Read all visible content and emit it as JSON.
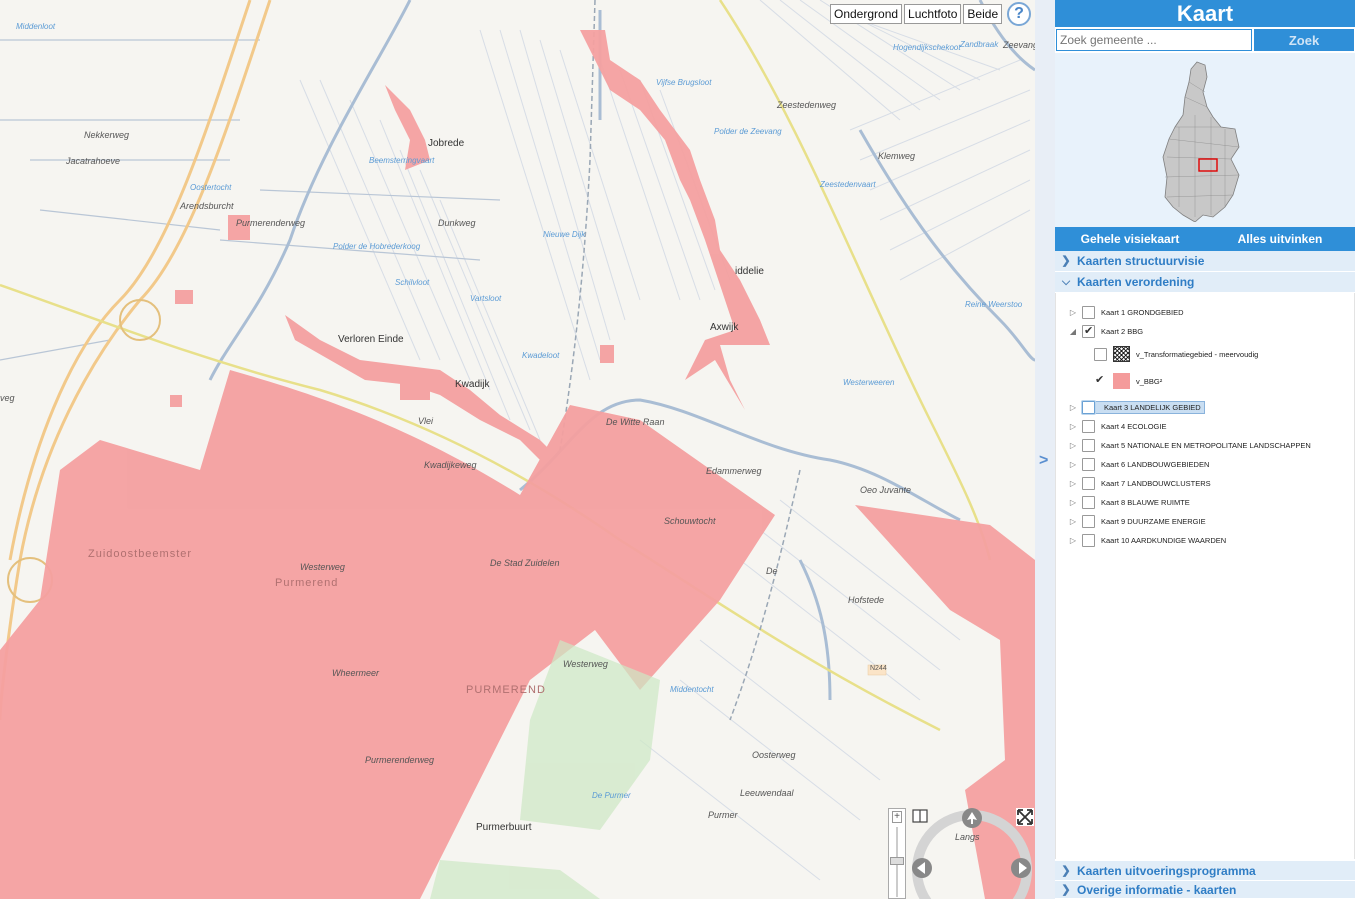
{
  "map": {
    "type_buttons": [
      "Ondergrond",
      "Luchtfoto",
      "Beide"
    ],
    "help": "?",
    "collapse_arrow": ">",
    "zoom_plus": "+",
    "labels": [
      {
        "text": "Jobrede",
        "cls": "town"
      },
      {
        "text": "Verloren Einde",
        "cls": "town"
      },
      {
        "text": "Kwadijk",
        "cls": "town"
      },
      {
        "text": "Axwijk",
        "cls": "town"
      },
      {
        "text": "iddelie",
        "cls": "town"
      },
      {
        "text": "Nekkerweg",
        "cls": ""
      },
      {
        "text": "Jacatrahoeve",
        "cls": ""
      },
      {
        "text": "Arendsburcht",
        "cls": ""
      },
      {
        "text": "Purmerenderweg",
        "cls": ""
      },
      {
        "text": "Dunkweg",
        "cls": ""
      },
      {
        "text": "Zeestedenweg",
        "cls": ""
      },
      {
        "text": "Klemweg",
        "cls": ""
      },
      {
        "text": "Edammerweg",
        "cls": ""
      },
      {
        "text": "Oeo Juvante",
        "cls": ""
      },
      {
        "text": "Hofstede",
        "cls": ""
      },
      {
        "text": "Westerweg",
        "cls": ""
      },
      {
        "text": "Oosterweg",
        "cls": ""
      },
      {
        "text": "Leeuwendaal",
        "cls": ""
      },
      {
        "text": "Purmerbuurt",
        "cls": "town"
      },
      {
        "text": "Middenloot",
        "cls": "water"
      },
      {
        "text": "Oostertocht",
        "cls": "water"
      },
      {
        "text": "Beemsterringvaart",
        "cls": "water"
      },
      {
        "text": "Polder de Hobrederkoog",
        "cls": "water"
      },
      {
        "text": "Nieuwe Dijk",
        "cls": "water"
      },
      {
        "text": "Schilvloot",
        "cls": "water"
      },
      {
        "text": "Vartsloot",
        "cls": "water"
      },
      {
        "text": "Kwadeloot",
        "cls": "water"
      },
      {
        "text": "Vijfse Brugsloot",
        "cls": "water"
      },
      {
        "text": "Polder de Zeevang",
        "cls": "water"
      },
      {
        "text": "Zeestedenvaart",
        "cls": "water"
      },
      {
        "text": "Westerweeren",
        "cls": "water"
      },
      {
        "text": "Reine Weerstoo",
        "cls": "water"
      },
      {
        "text": "Hogendijkschekoot",
        "cls": "water"
      },
      {
        "text": "Zandbraak",
        "cls": "water"
      },
      {
        "text": "Middentocht",
        "cls": "water"
      },
      {
        "text": "De Purmer",
        "cls": "water"
      },
      {
        "text": "Vlei",
        "cls": ""
      },
      {
        "text": "De Witte Raan",
        "cls": ""
      },
      {
        "text": "Zuidoostbeemster",
        "cls": "big"
      },
      {
        "text": "Purmerend",
        "cls": "big"
      },
      {
        "text": "PURMEREND",
        "cls": "big"
      },
      {
        "text": "Wheermeer",
        "cls": ""
      },
      {
        "text": "De Stad Zuidelen",
        "cls": ""
      },
      {
        "text": "Westerweg",
        "cls": ""
      },
      {
        "text": "Zeevangdijk",
        "cls": ""
      },
      {
        "text": "N244",
        "cls": ""
      },
      {
        "text": "veg",
        "cls": ""
      },
      {
        "text": "Kwadijkeweg",
        "cls": ""
      },
      {
        "text": "Purmerenderweg",
        "cls": ""
      },
      {
        "text": "Schouwtocht",
        "cls": ""
      },
      {
        "text": "Purmer",
        "cls": ""
      },
      {
        "text": "De",
        "cls": ""
      },
      {
        "text": "Langs",
        "cls": ""
      }
    ]
  },
  "panel": {
    "title": "Kaart",
    "search_placeholder": "Zoek gemeente ...",
    "search_button": "Zoek",
    "actions": [
      "Gehele visiekaart",
      "Alles uitvinken"
    ],
    "sections_top": [
      {
        "label": "Kaarten structuurvisie",
        "open": false
      },
      {
        "label": "Kaarten verordening",
        "open": true
      }
    ],
    "layers": [
      {
        "label": "Kaart 1 GRONDGEBIED",
        "checked": false,
        "expander": "▷",
        "indent": 0
      },
      {
        "label": "Kaart 2 BBG",
        "checked": true,
        "expander": "◢",
        "indent": 0
      },
      {
        "label": "v_Transformatiegebied - meervoudig",
        "checked": false,
        "expander": "",
        "indent": 1,
        "swatch": "hatch"
      },
      {
        "label": "v_BBG²",
        "checked": true,
        "expander": "",
        "indent": 1,
        "swatch": "pink"
      },
      {
        "label": "Kaart 3 LANDELIJK GEBIED",
        "checked": false,
        "expander": "▷",
        "indent": 0,
        "highlight": true
      },
      {
        "label": "Kaart 4 ECOLOGIE",
        "checked": false,
        "expander": "▷",
        "indent": 0
      },
      {
        "label": "Kaart 5 NATIONALE EN METROPOLITANE LANDSCHAPPEN",
        "checked": false,
        "expander": "▷",
        "indent": 0
      },
      {
        "label": "Kaart 6 LANDBOUWGEBIEDEN",
        "checked": false,
        "expander": "▷",
        "indent": 0
      },
      {
        "label": "Kaart 7 LANDBOUWCLUSTERS",
        "checked": false,
        "expander": "▷",
        "indent": 0
      },
      {
        "label": "Kaart 8 BLAUWE RUIMTE",
        "checked": false,
        "expander": "▷",
        "indent": 0
      },
      {
        "label": "Kaart 9 DUURZAME ENERGIE",
        "checked": false,
        "expander": "▷",
        "indent": 0
      },
      {
        "label": "Kaart 10 AARDKUNDIGE WAARDEN",
        "checked": false,
        "expander": "▷",
        "indent": 0
      }
    ],
    "sections_bottom": [
      {
        "label": "Kaarten uitvoeringsprogramma"
      },
      {
        "label": "Overige informatie - kaarten"
      }
    ]
  },
  "colors": {
    "accent": "#2f8fd8",
    "bbg_pink": "#f49b9b",
    "water": "#5b9bd5"
  }
}
